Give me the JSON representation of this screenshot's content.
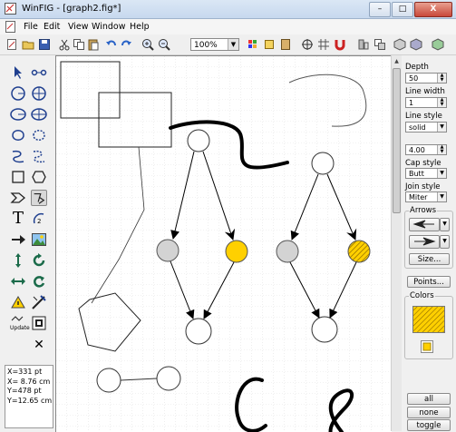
{
  "window": {
    "title": "WinFIG - [graph2.fig*]",
    "minimize": "–",
    "maximize": "□",
    "close": "X"
  },
  "menu": {
    "file": "File",
    "edit": "Edit",
    "view": "View",
    "window": "Window",
    "help": "Help"
  },
  "toolbar": {
    "zoom_value": "100%",
    "icons": [
      "new-icon",
      "open-icon",
      "save-icon",
      "cut-icon",
      "copy-icon",
      "paste-icon",
      "undo-icon",
      "redo-icon",
      "zoom-in-icon",
      "zoom-out-icon",
      "layers-icon",
      "fill-icon",
      "crosshair-icon",
      "snap-grid-icon",
      "magnet-icon",
      "align-icon",
      "arrange-icon",
      "library-icon",
      "export-icon"
    ]
  },
  "status": {
    "x_pt": "X=331 pt",
    "x_cm": "X= 8.76 cm",
    "y_pt": "Y=478 pt",
    "y_cm": "Y=12.65 cm"
  },
  "left_tools": {
    "text_tool": "T",
    "update_label": "Update",
    "delete_symbol": "✕"
  },
  "properties": {
    "depth_label": "Depth",
    "depth_value": "50",
    "line_width_label": "Line width",
    "line_width_value": "1",
    "line_style_label": "Line style",
    "line_style_value": "solid",
    "dash_value": "4.00",
    "cap_style_label": "Cap style",
    "cap_style_value": "Butt",
    "join_style_label": "Join style",
    "join_style_value": "Miter",
    "arrows_label": "Arrows",
    "size_button": "Size...",
    "points_button": "Points...",
    "colors_label": "Colors",
    "all_button": "all",
    "none_button": "none",
    "toggle_button": "toggle"
  },
  "colors": {
    "accent_yellow": "#ffd000",
    "node_gray": "#d3d3d3"
  }
}
